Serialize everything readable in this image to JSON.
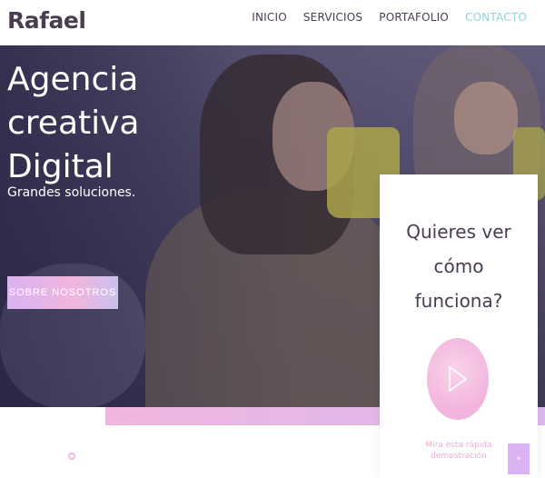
{
  "header": {
    "brand": "Rafael",
    "nav": [
      {
        "label": "INICIO",
        "active": false
      },
      {
        "label": "SERVICIOS",
        "active": false
      },
      {
        "label": "PORTAFOLIO",
        "active": false
      },
      {
        "label": "CONTACTO",
        "active": true
      }
    ],
    "active_color": "#8fd5d8"
  },
  "hero": {
    "title_line1": "Agencia creativa",
    "title_line2": "Digital",
    "subtitle": "Grandes soluciones.",
    "button_label": "SOBRE NOSOTROS"
  },
  "card": {
    "title_line1": "Quieres ver",
    "title_line2": "cómo",
    "title_line3": "funciona?",
    "caption_line1": "Mira esta rápida",
    "caption_line2": "demostración",
    "play_icon": "play-icon"
  },
  "scroll_top": {
    "label": "»",
    "icon": "arrow-up-icon"
  },
  "colors": {
    "brand_text": "#4a3d52",
    "accent_pink": "#f0b6dd",
    "accent_lilac": "#d9b3f2"
  }
}
